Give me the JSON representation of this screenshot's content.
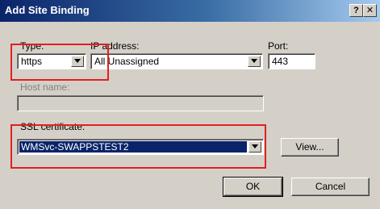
{
  "window": {
    "title": "Add Site Binding",
    "help_button": "?",
    "close_button": "✕"
  },
  "form": {
    "type": {
      "label": "Type:",
      "value": "https"
    },
    "ip_address": {
      "label": "IP address:",
      "value": "All Unassigned"
    },
    "port": {
      "label": "Port:",
      "value": "443"
    },
    "host_name": {
      "label": "Host name:",
      "value": ""
    },
    "ssl_certificate": {
      "label": "SSL certificate:",
      "value": "WMSvc-SWAPPSTEST2"
    },
    "view_button": "View..."
  },
  "footer": {
    "ok_button": "OK",
    "cancel_button": "Cancel"
  },
  "colors": {
    "titlebar_start": "#0a246a",
    "highlight_box": "#e02020",
    "selection": "#0a246a"
  }
}
